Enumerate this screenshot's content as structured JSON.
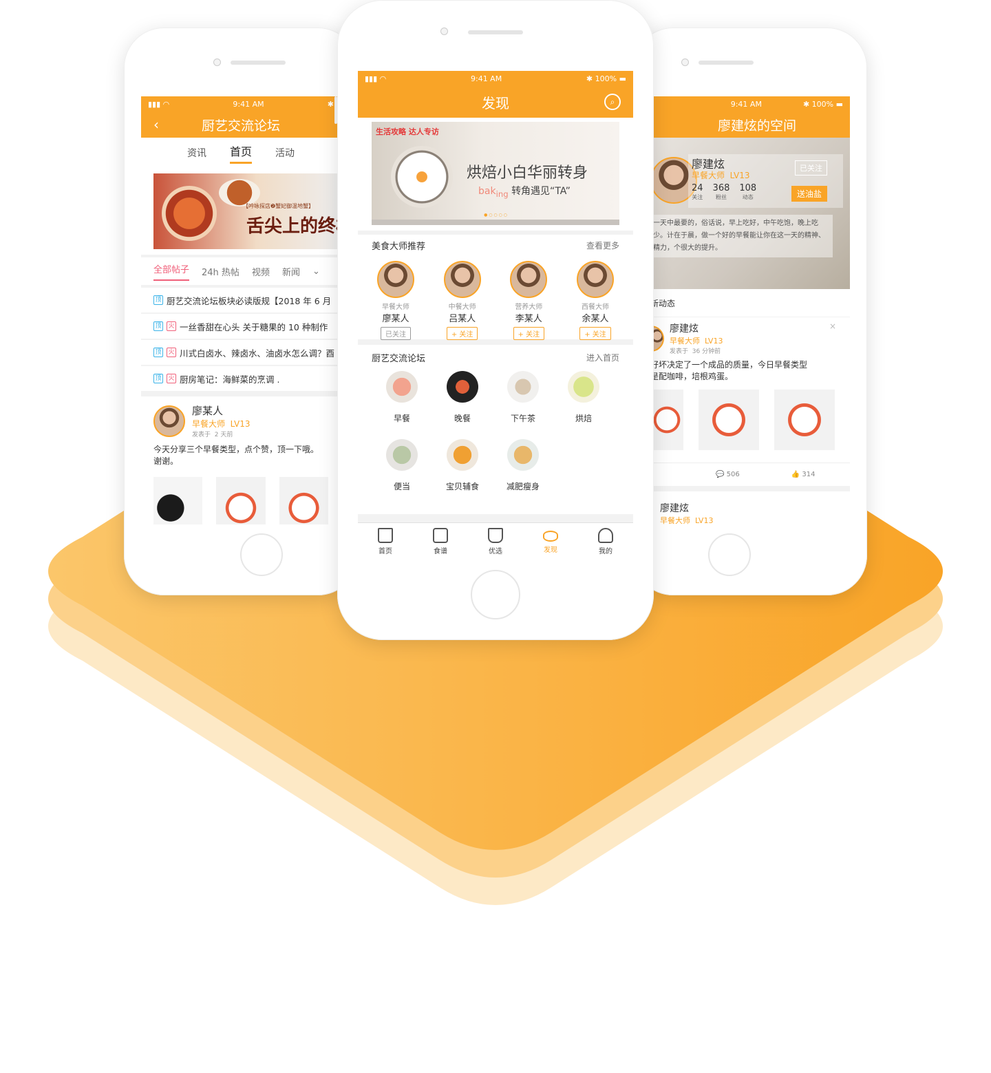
{
  "status": {
    "time": "9:41 AM",
    "battery": "100%"
  },
  "left": {
    "title": "厨艺交流论坛",
    "back_icon": "chevron-left-icon",
    "tabs": [
      "资讯",
      "首页",
      "活动"
    ],
    "banner_tag": "【吟咏探店❷蟹妃御温地蟹】",
    "banner_text": "舌尖上的终极美",
    "filters": [
      "全部帖子",
      "24h 热帖",
      "视频",
      "新闻"
    ],
    "posts": [
      {
        "tags": [
          "顶"
        ],
        "text": "厨艺交流论坛板块必读版规【2018 年 6 月"
      },
      {
        "tags": [
          "顶",
          "火"
        ],
        "text": "一丝香甜在心头 关于糖果的 10 种制作"
      },
      {
        "tags": [
          "顶",
          "火"
        ],
        "text": "川式白卤水、辣卤水、油卤水怎么调？酉"
      },
      {
        "tags": [
          "顶",
          "火"
        ],
        "text": "厨房笔记：海鲜菜的烹调 ."
      }
    ],
    "author": {
      "name": "廖某人",
      "title": "早餐大师",
      "level": "LV13",
      "posted": "发表于",
      "ago": "2 天前",
      "content": "今天分享三个早餐类型，点个赞，顶一下哦。谢谢。"
    }
  },
  "center": {
    "title": "发现",
    "search_icon": "search-icon",
    "banner": {
      "tag1": "生活攻略",
      "tag2": "达人专访",
      "line1": "烘焙小白华丽转身",
      "line2a": "bak",
      "line2b": "ing",
      "line2c": "转角遇见“TA”"
    },
    "masters": {
      "heading": "美食大师推荐",
      "more": "查看更多",
      "items": [
        {
          "role": "早餐大师",
          "name": "廖某人",
          "action": "已关注",
          "followed": true
        },
        {
          "role": "中餐大师",
          "name": "吕某人",
          "action": "+ 关注",
          "followed": false
        },
        {
          "role": "营养大师",
          "name": "李某人",
          "action": "+ 关注",
          "followed": false
        },
        {
          "role": "西餐大师",
          "name": "余某人",
          "action": "+ 关注",
          "followed": false
        }
      ]
    },
    "forum": {
      "heading": "厨艺交流论坛",
      "more": "进入首页",
      "items": [
        "早餐",
        "晚餐",
        "下午茶",
        "烘焙",
        "便当",
        "宝贝辅食",
        "减肥瘦身"
      ]
    },
    "tabbar": [
      {
        "label": "首页",
        "icon": "home-icon",
        "active": false
      },
      {
        "label": "食谱",
        "icon": "book-icon",
        "active": false
      },
      {
        "label": "优选",
        "icon": "bag-icon",
        "active": false
      },
      {
        "label": "发现",
        "icon": "eye-icon",
        "active": true
      },
      {
        "label": "我的",
        "icon": "user-icon",
        "active": false
      }
    ],
    "colors": {
      "accent": "#f9a427"
    }
  },
  "right": {
    "title": "廖建炫的空间",
    "profile": {
      "name": "廖建炫",
      "title": "早餐大师",
      "level": "LV13",
      "followed_label": "已关注",
      "gift_label": "送油盐",
      "stats": [
        {
          "value": "24",
          "label": "关注"
        },
        {
          "value": "368",
          "label": "粉丝"
        },
        {
          "value": "108",
          "label": "动态"
        }
      ],
      "bio": "一天中最要的，俗话说，早上吃好，中午吃饱，晚上吃少。计在于晨，做一个好的早餐能让你在这一天的精神、精力，个很大的提升。"
    },
    "section": "新动态",
    "post": {
      "name": "廖建炫",
      "title": "早餐大师",
      "level": "LV13",
      "posted": "发表于",
      "ago": "36 分钟前",
      "content": "好坏决定了一个成品的质量，今日早餐类型是配咖啡，培根鸡蛋。",
      "comments": "506",
      "likes": "314"
    },
    "post2": {
      "name": "廖建炫",
      "title": "早餐大师",
      "level": "LV13"
    }
  }
}
